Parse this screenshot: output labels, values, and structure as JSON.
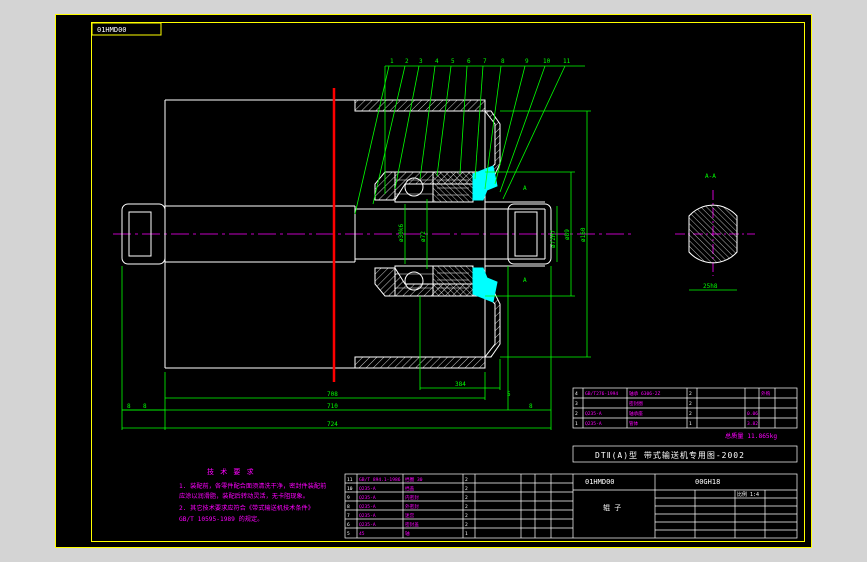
{
  "colors": {
    "frame": "#ffff00",
    "outline": "#ffffff",
    "dimension": "#00ff00",
    "centerline": "#ff00ff",
    "cut_line": "#ff0000",
    "seal": "#00ffff",
    "text_magenta": "#ff00ff",
    "workspace": "#d4d4d4",
    "canvas": "#000000"
  },
  "drawing": {
    "corner_code": "01HMD00",
    "balloons": [
      "1",
      "2",
      "3",
      "4",
      "5",
      "6",
      "7",
      "8",
      "9",
      "10",
      "11"
    ],
    "dims": {
      "total_length": "724",
      "mid_length": "710",
      "shell_length": "708",
      "hub_length": "384",
      "left_a": "8",
      "left_b": "8",
      "right_a": "5",
      "right_b": "8"
    },
    "dia": {
      "shaft": "ø30k6",
      "seat": "ø72",
      "bearing": "ø72H7",
      "shell": "ø89",
      "outer": "ø160"
    },
    "section_label": "A-A",
    "section_marks": [
      "A",
      "A"
    ],
    "key_dim": "25h8"
  },
  "notes": {
    "title": "技 术 要 求",
    "lines": [
      "1. 装配前，各零件配合面须清洗干净，密封件装配前",
      "   应涂以润滑脂，装配后转动灵活，无卡阻现象。",
      "2. 其它技术要求应符合《带式输送机技术条件》",
      "   GB/T 10595-1989 的规定。"
    ]
  },
  "title_block": {
    "mass": "总质量 11.865kg",
    "series": "DTⅡ(A)型  带式输送机专用图-2002",
    "drawing_no": "01HMD00",
    "code": "00GH18",
    "part_name": "辊  子",
    "scale_label": "比例 1:4",
    "upper_rows": [
      [
        "4",
        "GB/T276-1994",
        "轴承 6306-2Z",
        "2",
        "",
        "",
        "外购"
      ],
      [
        "3",
        "",
        "密封圈",
        "2",
        "",
        "",
        ""
      ],
      [
        "2",
        "Q235-A",
        "轴承座",
        "2",
        "",
        "0.06",
        ""
      ],
      [
        "1",
        "Q235-A",
        "管体",
        "1",
        "",
        "3.82",
        ""
      ]
    ],
    "lower_rows": [
      [
        "11",
        "GB/T 894.1-1986",
        "挡圈 30",
        "2",
        "",
        "",
        ""
      ],
      [
        "10",
        "Q235-A",
        "挡盖",
        "2",
        "",
        "",
        ""
      ],
      [
        "9",
        "Q235-A",
        "内密封",
        "2",
        "",
        "",
        ""
      ],
      [
        "8",
        "Q235-A",
        "外密封",
        "2",
        "",
        "",
        ""
      ],
      [
        "7",
        "Q235-A",
        "迷宫",
        "2",
        "",
        "",
        ""
      ],
      [
        "6",
        "Q235-A",
        "密封盖",
        "2",
        "",
        "",
        ""
      ],
      [
        "5",
        "45",
        "轴",
        "1",
        "",
        "",
        ""
      ]
    ]
  }
}
